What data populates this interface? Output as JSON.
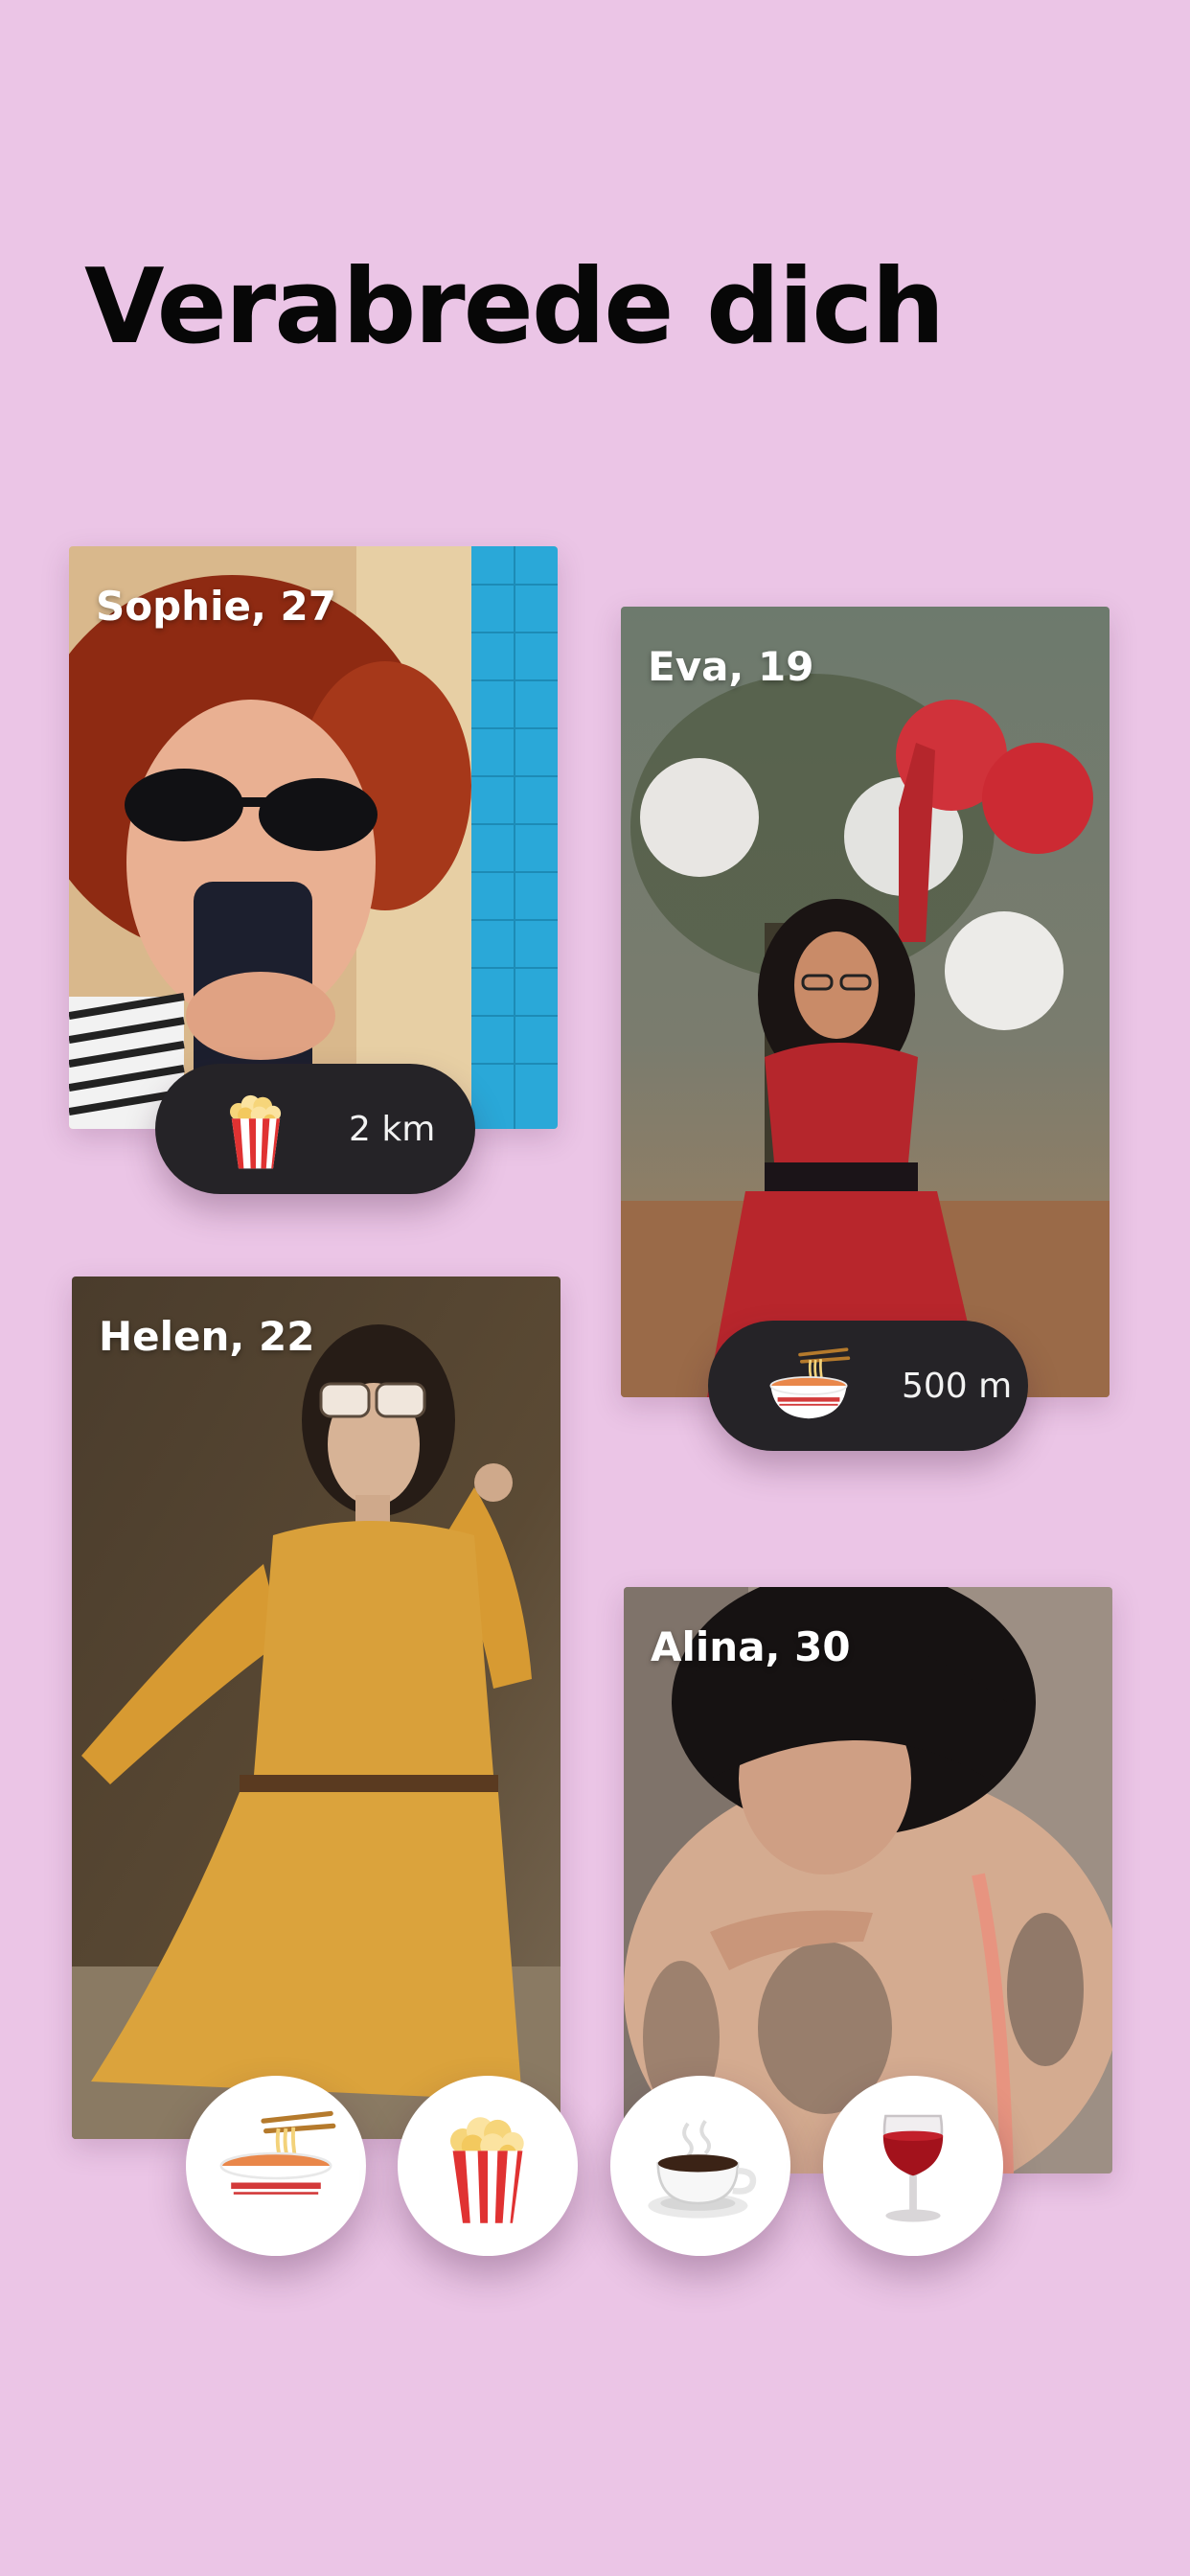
{
  "headline": "Verabrede dich",
  "profiles": [
    {
      "name": "Sophie, 27"
    },
    {
      "name": "Eva, 19"
    },
    {
      "name": "Helen, 22"
    },
    {
      "name": "Alina, 30"
    }
  ],
  "pills": [
    {
      "icon": "popcorn-icon",
      "distance": "2 km"
    },
    {
      "icon": "noodle-bowl-icon",
      "distance": "500 m"
    }
  ],
  "activities": [
    {
      "icon": "noodle-bowl-icon"
    },
    {
      "icon": "popcorn-icon"
    },
    {
      "icon": "coffee-cup-icon"
    },
    {
      "icon": "wine-glass-icon"
    }
  ],
  "colors": {
    "background": "#ebc5e6",
    "pill": "#252327",
    "headline": "#070707"
  }
}
